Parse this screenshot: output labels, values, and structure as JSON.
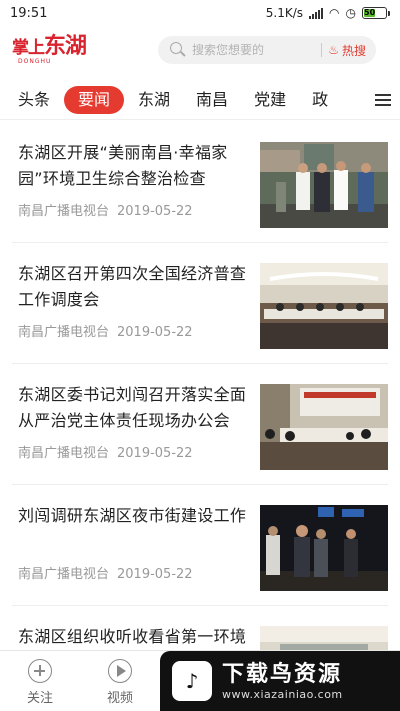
{
  "status": {
    "time": "19:51",
    "net_speed": "5.1K/s",
    "battery": "50"
  },
  "header": {
    "logo_text_small": "掌上",
    "logo_text_big": "东湖",
    "logo_sub": "DONGHU",
    "search_placeholder": "搜索您想要的",
    "hot_label": "热搜"
  },
  "tabs": [
    {
      "label": "头条"
    },
    {
      "label": "要闻",
      "active": true
    },
    {
      "label": "东湖"
    },
    {
      "label": "南昌"
    },
    {
      "label": "党建"
    },
    {
      "label": "政"
    }
  ],
  "news": [
    {
      "title": "东湖区开展“美丽南昌·幸福家园”环境卫生综合整治检查",
      "source": "南昌广播电视台",
      "date": "2019-05-22"
    },
    {
      "title": "东湖区召开第四次全国经济普查工作调度会",
      "source": "南昌广播电视台",
      "date": "2019-05-22"
    },
    {
      "title": "东湖区委书记刘闯召开落实全面从严治党主体责任现场办公会",
      "source": "南昌广播电视台",
      "date": "2019-05-22"
    },
    {
      "title": "刘闯调研东湖区夜市街建设工作",
      "source": "南昌广播电视台",
      "date": "2019-05-22"
    },
    {
      "title": "东湖区组织收听收看省第一环境",
      "source": "",
      "date": ""
    }
  ],
  "bottom_nav": {
    "follow": "关注",
    "video": "视频"
  },
  "watermark": {
    "brand": "下载鸟资源",
    "url": "www.xiazainiao.com"
  },
  "colors": {
    "brand_red": "#e53a2f",
    "logo_red": "#d9232e"
  }
}
